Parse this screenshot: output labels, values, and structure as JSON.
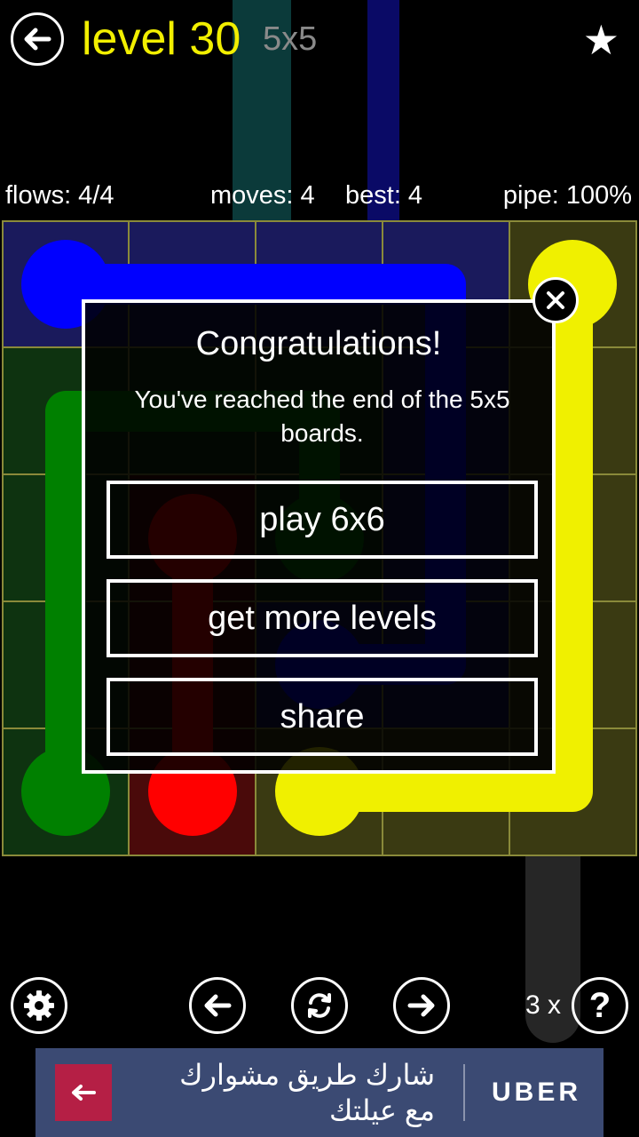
{
  "header": {
    "level_title": "level 30",
    "board_size": "5x5"
  },
  "stats": {
    "flows": "flows: 4/4",
    "moves": "moves: 4",
    "best": "best: 4",
    "pipe": "pipe: 100%"
  },
  "colors": {
    "blue": "#0000ff",
    "green": "#008000",
    "red": "#ff0000",
    "yellow": "#f0f000",
    "grid_line": "#8a8a3a"
  },
  "modal": {
    "title": "Congratulations!",
    "message": "You've reached the end of the 5x5 boards.",
    "buttons": [
      {
        "label": "play 6x6"
      },
      {
        "label": "get more levels"
      },
      {
        "label": "share"
      }
    ]
  },
  "bottom_bar": {
    "hints_count": "3 x",
    "icons": [
      "gear-icon",
      "arrow-left-icon",
      "refresh-icon",
      "arrow-right-icon",
      "question-icon"
    ]
  },
  "ad": {
    "line1": "شارك طريق مشوارك",
    "line2": "مع عيلتك",
    "brand": "UBER"
  }
}
